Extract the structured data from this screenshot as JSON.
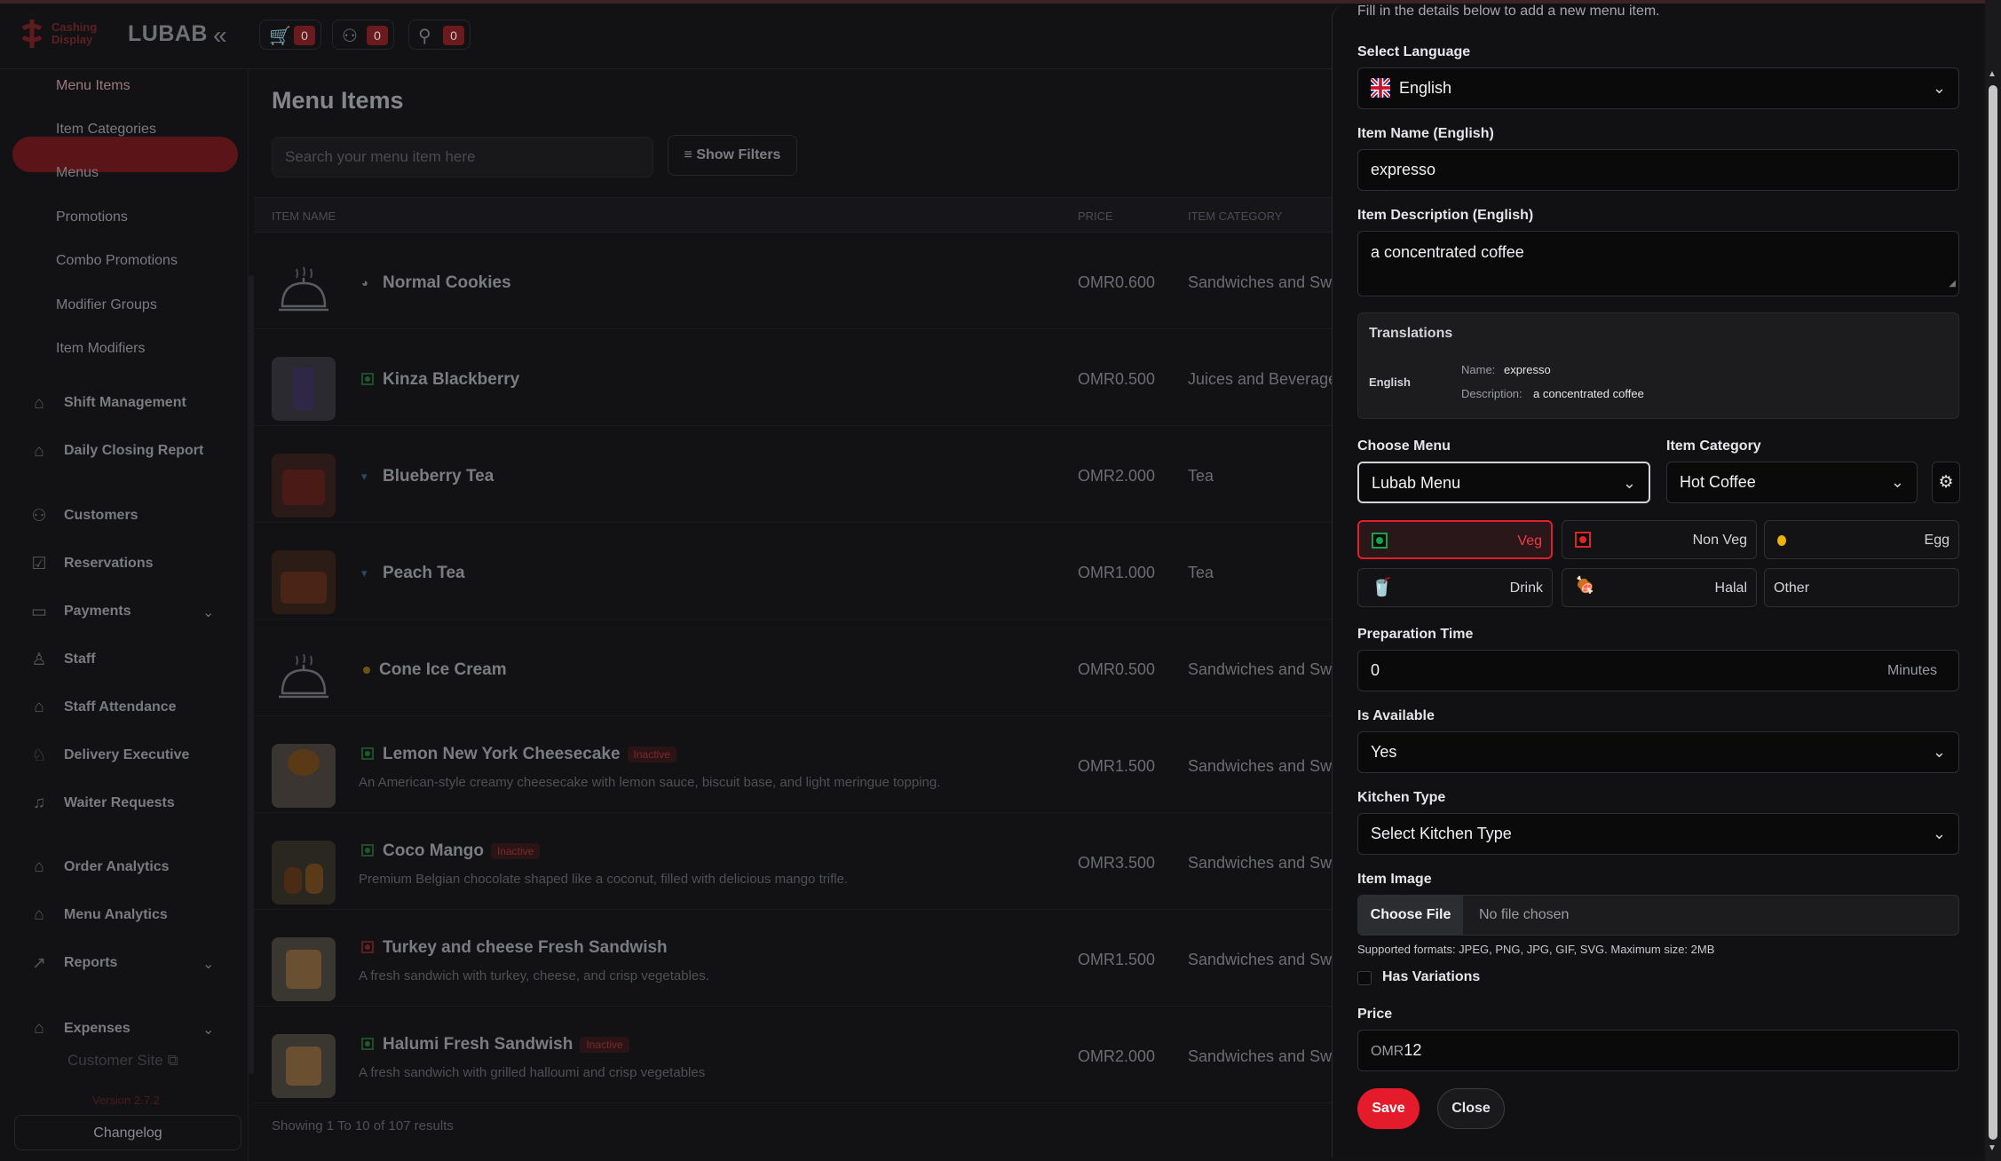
{
  "app": {
    "logo_text": [
      "Cashing",
      "Display"
    ],
    "brand": "LUBAB",
    "top_buttons": [
      {
        "icon": "cart-icon",
        "count": "0"
      },
      {
        "icon": "waiter-icon",
        "count": "0"
      },
      {
        "icon": "bell-hand-icon",
        "count": "0"
      }
    ]
  },
  "sidebar": {
    "sub_items": [
      "Menu Items",
      "Item Categories",
      "Menus",
      "Promotions",
      "Combo Promotions",
      "Modifier Groups",
      "Item Modifiers"
    ],
    "main_items": [
      {
        "label": "Shift Management",
        "icon": "home-icon"
      },
      {
        "label": "Daily Closing Report",
        "icon": "home-icon"
      },
      {
        "label": "Customers",
        "icon": "users-icon"
      },
      {
        "label": "Reservations",
        "icon": "calendar-icon"
      },
      {
        "label": "Payments",
        "icon": "wallet-icon",
        "chevron": true
      },
      {
        "label": "Staff",
        "icon": "user-icon"
      },
      {
        "label": "Staff Attendance",
        "icon": "home-icon"
      },
      {
        "label": "Delivery Executive",
        "icon": "bike-icon"
      },
      {
        "label": "Waiter Requests",
        "icon": "bell-icon"
      },
      {
        "label": "Order Analytics",
        "icon": "home-icon"
      },
      {
        "label": "Menu Analytics",
        "icon": "home-icon"
      },
      {
        "label": "Reports",
        "icon": "chart-icon",
        "chevron": true
      },
      {
        "label": "Expenses",
        "icon": "home-icon",
        "chevron": true
      }
    ],
    "customer_site": "Customer Site",
    "version": "Version 2.7.2",
    "changelog": "Changelog"
  },
  "main": {
    "title": "Menu Items",
    "search_placeholder": "Search your menu item here",
    "show_filters": "Show Filters",
    "columns": {
      "name": "ITEM NAME",
      "price": "PRICE",
      "category": "ITEM CATEGORY"
    },
    "rows": [
      {
        "name": "Normal Cookies",
        "desc": "",
        "price": "OMR0.600",
        "category": "Sandwiches and Swe",
        "inactive": false
      },
      {
        "name": "Kinza Blackberry",
        "desc": "",
        "price": "OMR0.500",
        "category": "Juices and Beverage",
        "inactive": false
      },
      {
        "name": "Blueberry Tea",
        "desc": "",
        "price": "OMR2.000",
        "category": "Tea",
        "inactive": false
      },
      {
        "name": "Peach Tea",
        "desc": "",
        "price": "OMR1.000",
        "category": "Tea",
        "inactive": false
      },
      {
        "name": "Cone Ice Cream",
        "desc": "",
        "price": "OMR0.500",
        "category": "Sandwiches and Swe",
        "inactive": false
      },
      {
        "name": "Lemon New York Cheesecake",
        "desc": "An American-style creamy cheesecake with lemon sauce, biscuit base, and light meringue topping.",
        "price": "OMR1.500",
        "category": "Sandwiches and Swe",
        "inactive": true
      },
      {
        "name": "Coco Mango",
        "desc": "Premium Belgian chocolate shaped like a coconut, filled with delicious mango trifle.",
        "price": "OMR3.500",
        "category": "Sandwiches and Swe",
        "inactive": true
      },
      {
        "name": "Turkey and cheese Fresh Sandwish",
        "desc": "A fresh sandwich with turkey, cheese, and crisp vegetables.",
        "price": "OMR1.500",
        "category": "Sandwiches and Swe",
        "inactive": false
      },
      {
        "name": "Halumi Fresh Sandwish",
        "desc": "A fresh sandwich with grilled halloumi and crisp vegetables",
        "price": "OMR2.000",
        "category": "Sandwiches and Swe",
        "inactive": true
      }
    ],
    "inactive_label": "Inactive",
    "showing": "Showing 1 To 10 of 107 results"
  },
  "drawer": {
    "subtitle": "Fill in the details below to add a new menu item.",
    "language_label": "Select Language",
    "language_value": "English",
    "name_label": "Item Name (English)",
    "name_value": "expresso",
    "desc_label": "Item Description (English)",
    "desc_value": "a concentrated coffee",
    "translations": {
      "title": "Translations",
      "lang": "English",
      "name_key": "Name:",
      "name_val": "expresso",
      "desc_key": "Description:",
      "desc_val": "a concentrated coffee"
    },
    "menu_label": "Choose Menu",
    "menu_value": "Lubab Menu",
    "category_label": "Item Category",
    "category_value": "Hot Coffee",
    "types": [
      {
        "label": "Veg",
        "selected": true
      },
      {
        "label": "Non Veg",
        "selected": false
      },
      {
        "label": "Egg",
        "selected": false
      },
      {
        "label": "Drink",
        "selected": false
      },
      {
        "label": "Halal",
        "selected": false
      },
      {
        "label": "Other",
        "selected": false
      }
    ],
    "prep_label": "Preparation Time",
    "prep_value": "0",
    "prep_unit": "Minutes",
    "available_label": "Is Available",
    "available_value": "Yes",
    "kitchen_label": "Kitchen Type",
    "kitchen_value": "Select Kitchen Type",
    "image_label": "Item Image",
    "choose_file": "Choose File",
    "no_file": "No file chosen",
    "formats": "Supported formats: JPEG, PNG, JPG, GIF, SVG. Maximum size: 2MB",
    "variations_label": "Has Variations",
    "price_label": "Price",
    "price_prefix": "OMR",
    "price_value": "12",
    "save": "Save",
    "close": "Close"
  },
  "colors": {
    "accent": "#e31b2a",
    "veg": "#16a34a",
    "nonveg": "#dc2626",
    "egg": "#eab308"
  }
}
